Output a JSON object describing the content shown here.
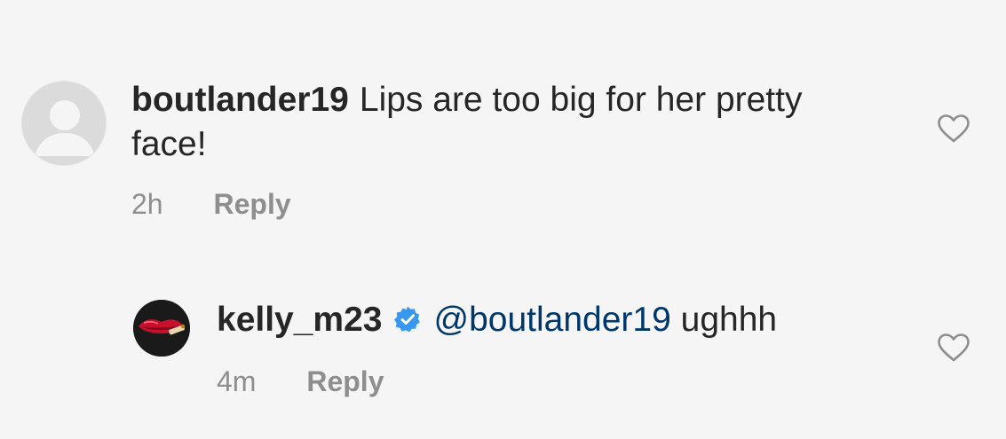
{
  "comments": [
    {
      "username": "boutlander19",
      "text": "Lips are too big for her pretty face!",
      "time": "2h",
      "reply_label": "Reply",
      "avatar_icon": "default-profile-icon",
      "like_icon": "heart-outline-icon"
    },
    {
      "username": "kelly_m23",
      "verified": true,
      "mention": "@boutlander19",
      "text": "ughhh",
      "time": "4m",
      "reply_label": "Reply",
      "avatar_icon": "lips-cigarette-avatar",
      "like_icon": "heart-outline-icon"
    }
  ],
  "colors": {
    "background": "#f5f5f5",
    "text": "#262626",
    "secondary": "#8e8e8e",
    "mention": "#00376b",
    "verified": "#3897f0"
  }
}
